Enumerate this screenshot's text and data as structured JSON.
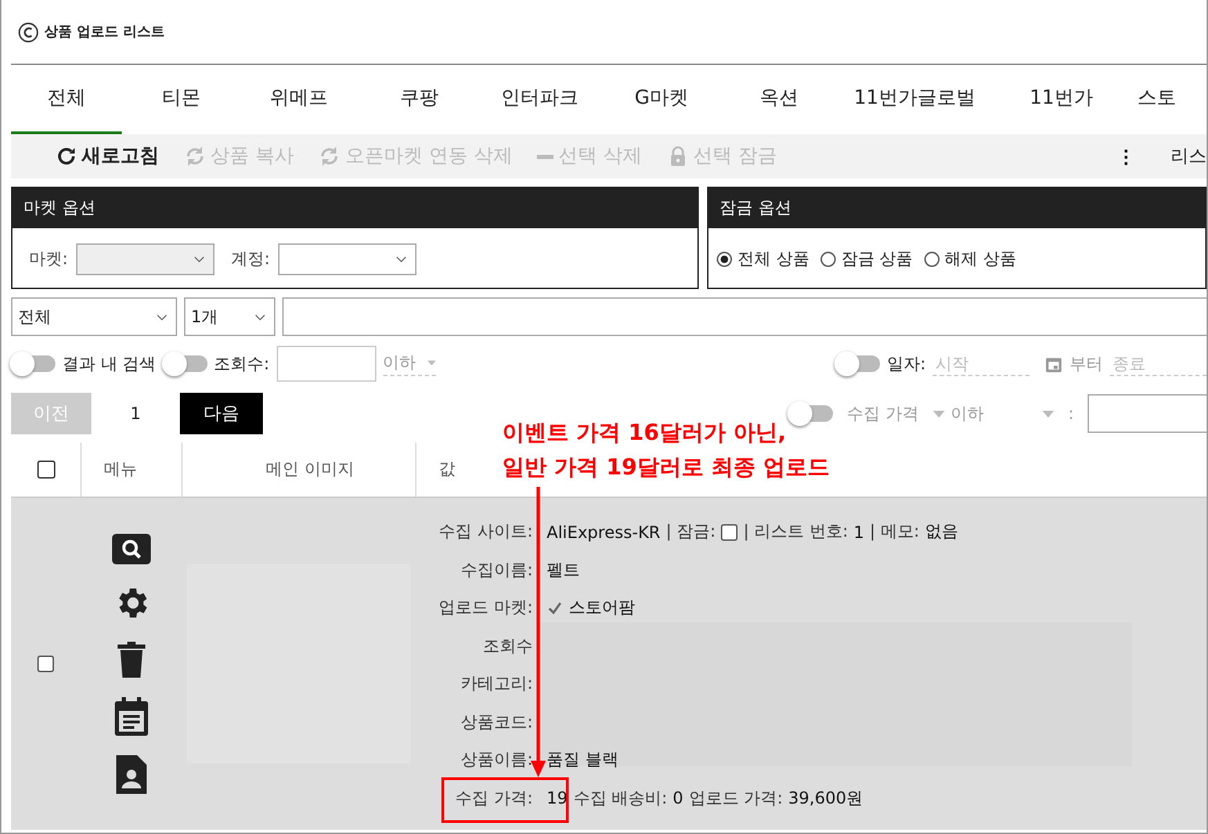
{
  "window": {
    "title": "상품 업로드 리스트"
  },
  "tabs": [
    {
      "label": "전체",
      "selected": true
    },
    {
      "label": "티몬",
      "selected": false
    },
    {
      "label": "위메프",
      "selected": false
    },
    {
      "label": "쿠팡",
      "selected": false
    },
    {
      "label": "인터파크",
      "selected": false
    },
    {
      "label": "G마켓",
      "selected": false
    },
    {
      "label": "옥션",
      "selected": false
    },
    {
      "label": "11번가글로벌",
      "selected": false
    },
    {
      "label": "11번가",
      "selected": false
    },
    {
      "label": "스토",
      "selected": false
    }
  ],
  "toolbar": [
    {
      "kind": "refresh",
      "label": "새로고침",
      "disabled": false
    },
    {
      "kind": "sync",
      "label": "상품 복사",
      "disabled": true
    },
    {
      "kind": "sync",
      "label": "오픈마켓 연동 삭제",
      "disabled": true
    },
    {
      "kind": "minus",
      "label": "선택 삭제",
      "disabled": true
    },
    {
      "kind": "lock",
      "label": "선택 잠금",
      "disabled": true
    }
  ],
  "toolbar_more": "⋮",
  "toolbar_right": "리스",
  "market_panel": {
    "title": "마켓 옵션",
    "market_label": "마켓:",
    "account_label": "계정:"
  },
  "lock_panel": {
    "title": "잠금 옵션",
    "options": [
      {
        "label": "전체 상품",
        "selected": true
      },
      {
        "label": "잠금 상품",
        "selected": false
      },
      {
        "label": "해제 상품",
        "selected": false
      }
    ]
  },
  "filter": {
    "scope": "전체",
    "count": "1개"
  },
  "toggles": {
    "in_result": {
      "label": "결과 내 검색",
      "on": false
    },
    "views": {
      "label": "조회수:",
      "on": false
    },
    "below": "이하",
    "date": {
      "label": "일자:",
      "on": false
    },
    "start_placeholder": "시작",
    "from": "부터",
    "end_placeholder": "종료"
  },
  "pager": {
    "prev": "이전",
    "page": "1",
    "next": "다음",
    "price_toggle": {
      "label": "수집 가격",
      "on": false
    },
    "price_below": "이하",
    "colon": ":"
  },
  "table": {
    "all_checked": false,
    "columns": [
      "메뉴",
      "메인 이미지",
      "값"
    ],
    "rows": [
      {
        "checked": false,
        "fields": [
          {
            "kind": "site",
            "label": "수집 사이트:",
            "site": "AliExpress-KR",
            "lock_label": "| 잠금:",
            "locked": false,
            "list_label": "| 리스트 번호:",
            "list_no": "1",
            "memo_label": "| 메모:",
            "memo": "없음"
          },
          {
            "kind": "text",
            "label": "수집이름:",
            "value": "펠트"
          },
          {
            "kind": "check",
            "label": "업로드 마켓:",
            "checked": true,
            "value": "스토어팜"
          },
          {
            "kind": "text",
            "label": "조회수"
          },
          {
            "kind": "text",
            "label": "카테고리:"
          },
          {
            "kind": "text",
            "label": "상품코드:"
          },
          {
            "kind": "text",
            "label": "상품이름:",
            "value": "품질 블랙"
          },
          {
            "kind": "price",
            "label": "수집 가격:",
            "value": "19",
            "ship_label": "수집 배송비:",
            "ship": "0",
            "upload_label": "업로드 가격:",
            "upload": "39,600원"
          }
        ]
      }
    ]
  },
  "annotation": {
    "lines": [
      "이벤트 가격 16달러가 아닌,",
      "일반 가격 19달러로 최종 업로드"
    ]
  }
}
